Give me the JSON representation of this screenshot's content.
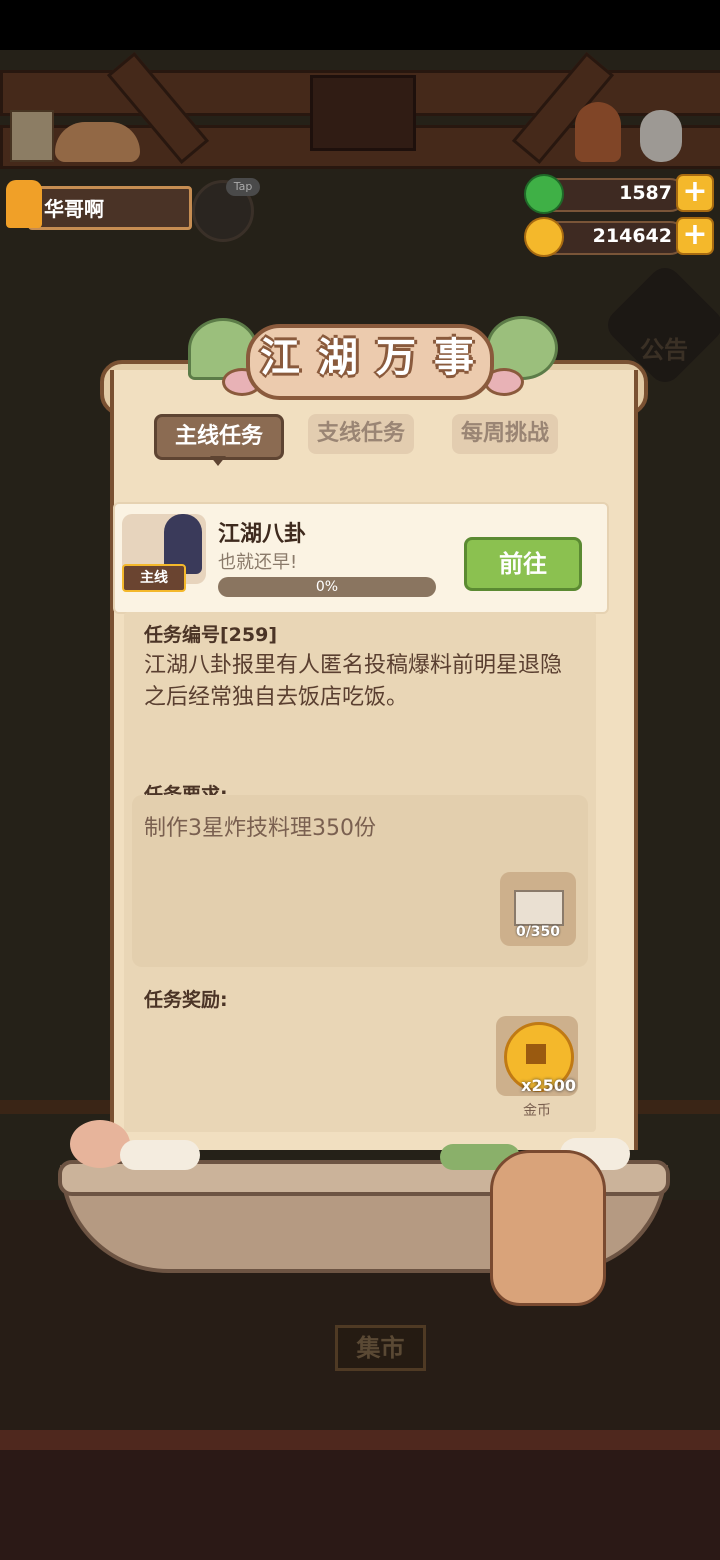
{
  "player": {
    "name": "华哥啊",
    "tap_label": "Tap"
  },
  "resources": {
    "jade": "1587",
    "coins": "214642"
  },
  "side_buttons": {
    "notice": "公告"
  },
  "dialog": {
    "title_chars": [
      "江",
      "湖",
      "万",
      "事"
    ],
    "tabs": [
      {
        "label": "主线任务",
        "active": true
      },
      {
        "label": "支线任务",
        "active": false
      },
      {
        "label": "每周挑战",
        "active": false
      }
    ],
    "task": {
      "name": "江湖八卦",
      "subtitle": "也就还早!",
      "badge": "主线",
      "progress_text": "0%",
      "progress_fraction": 0,
      "go_label": "前往"
    },
    "task_number": "任务编号[259]",
    "description": "江湖八卦报里有人匿名投稿爆料前明星退隐之后经常独自去饭店吃饭。",
    "requirement_label": "任务要求:",
    "requirement_text": "制作3星炸技料理350份",
    "requirement_progress": "0/350",
    "reward_label": "任务奖励:",
    "reward_count": "x2500",
    "reward_name": "金币"
  },
  "background": {
    "market_sign": "集市"
  },
  "colors": {
    "accent_green": "#8bc150",
    "gold": "#f4b82b",
    "panel": "#f1dfc0",
    "wood": "#7a5132"
  }
}
